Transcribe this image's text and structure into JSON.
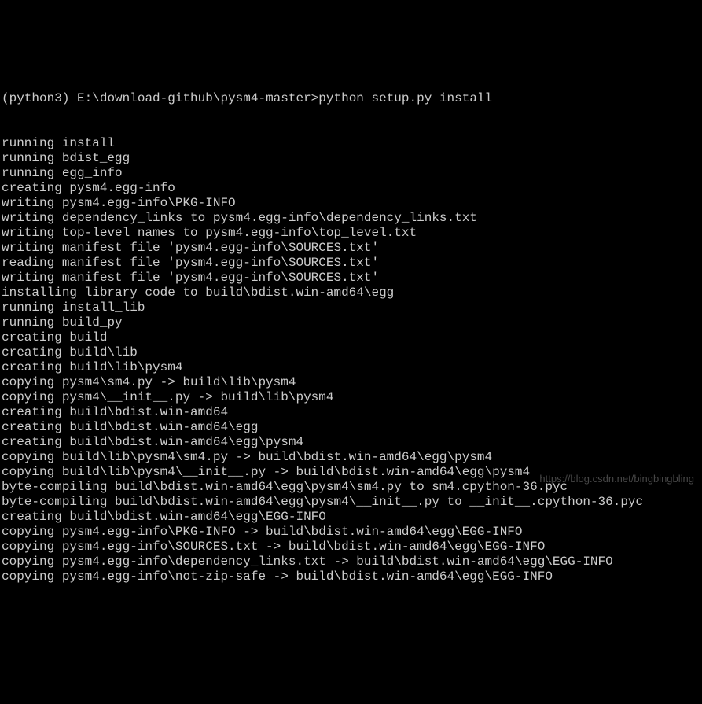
{
  "prompt": {
    "env": "(python3)",
    "path": "E:\\download-github\\pysm4-master>",
    "command": "python setup.py install"
  },
  "output_lines": [
    "running install",
    "running bdist_egg",
    "running egg_info",
    "creating pysm4.egg-info",
    "writing pysm4.egg-info\\PKG-INFO",
    "writing dependency_links to pysm4.egg-info\\dependency_links.txt",
    "writing top-level names to pysm4.egg-info\\top_level.txt",
    "writing manifest file 'pysm4.egg-info\\SOURCES.txt'",
    "reading manifest file 'pysm4.egg-info\\SOURCES.txt'",
    "writing manifest file 'pysm4.egg-info\\SOURCES.txt'",
    "installing library code to build\\bdist.win-amd64\\egg",
    "running install_lib",
    "running build_py",
    "creating build",
    "creating build\\lib",
    "creating build\\lib\\pysm4",
    "copying pysm4\\sm4.py -> build\\lib\\pysm4",
    "copying pysm4\\__init__.py -> build\\lib\\pysm4",
    "creating build\\bdist.win-amd64",
    "creating build\\bdist.win-amd64\\egg",
    "creating build\\bdist.win-amd64\\egg\\pysm4",
    "copying build\\lib\\pysm4\\sm4.py -> build\\bdist.win-amd64\\egg\\pysm4",
    "copying build\\lib\\pysm4\\__init__.py -> build\\bdist.win-amd64\\egg\\pysm4",
    "byte-compiling build\\bdist.win-amd64\\egg\\pysm4\\sm4.py to sm4.cpython-36.pyc",
    "byte-compiling build\\bdist.win-amd64\\egg\\pysm4\\__init__.py to __init__.cpython-36.pyc",
    "creating build\\bdist.win-amd64\\egg\\EGG-INFO",
    "copying pysm4.egg-info\\PKG-INFO -> build\\bdist.win-amd64\\egg\\EGG-INFO",
    "copying pysm4.egg-info\\SOURCES.txt -> build\\bdist.win-amd64\\egg\\EGG-INFO",
    "copying pysm4.egg-info\\dependency_links.txt -> build\\bdist.win-amd64\\egg\\EGG-INFO",
    "copying pysm4.egg-info\\not-zip-safe -> build\\bdist.win-amd64\\egg\\EGG-INFO"
  ],
  "watermark": "https://blog.csdn.net/bingbingbling"
}
